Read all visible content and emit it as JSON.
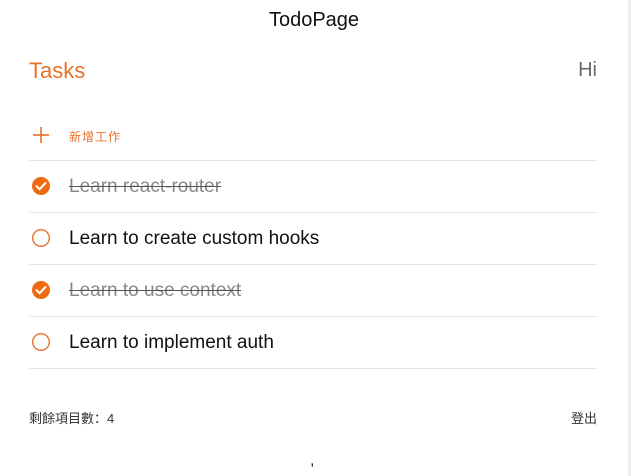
{
  "page": {
    "title": "TodoPage"
  },
  "header": {
    "tasks_title": "Tasks",
    "greeting": "Hi"
  },
  "add_task": {
    "label": "新增工作",
    "icon": "plus-icon"
  },
  "todos": [
    {
      "text": "Learn react-router",
      "done": true
    },
    {
      "text": "Learn to create custom hooks",
      "done": false
    },
    {
      "text": "Learn to use context",
      "done": true
    },
    {
      "text": "Learn to implement auth",
      "done": false
    }
  ],
  "footer": {
    "remaining_label": "剩餘項目數：4",
    "logout_label": "登出"
  },
  "bottom_mark": ",",
  "colors": {
    "accent": "#e8722a",
    "check_fill": "#f06a14",
    "divider": "#e5e5e5"
  }
}
